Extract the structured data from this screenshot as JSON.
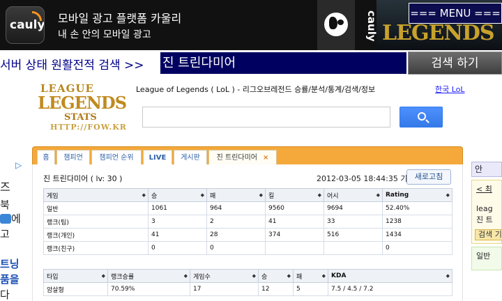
{
  "ad": {
    "brand": "cauly",
    "title": "모바일 광고 플랫폼 카울리",
    "subtitle": "내 손 안의 모바일 광고",
    "vertical_brand": "cauly",
    "logo_text": "LEGENDS",
    "menu_label": "=== MENU ==="
  },
  "search_bar": {
    "label": "서버 상태 원활전적 검색 >>",
    "value": "진 트린다미어",
    "button": "검색 하기"
  },
  "left_ad": {
    "lines": [
      "즈",
      "북",
      "에",
      "고",
      "트닝",
      "품을",
      "다"
    ]
  },
  "right_ad": {
    "box1": "안",
    "line1": "< 최",
    "line2": "leag",
    "line3": "진 트",
    "button": "검색 기",
    "line4": "일반"
  },
  "fow": {
    "logo_line1": "LEAGUE",
    "logo_line2": "LEGENDS",
    "logo_line3": "STATS",
    "logo_line4": "HTTP://FOW.KR",
    "title": "League of Legends ( LoL ) - 리그오브레전드 승률/분석/통계/검색/정보",
    "kr_link": "한국 LoL",
    "search_placeholder": ""
  },
  "tabs": [
    {
      "label": "홈"
    },
    {
      "label": "챔피언"
    },
    {
      "label": "챔피언 순위"
    },
    {
      "label": "LIVE"
    },
    {
      "label": "게시판"
    },
    {
      "label": "진 트린다미어",
      "close": "×"
    }
  ],
  "summoner": {
    "name_level": "진 트린다미어 ( lv: 30 )",
    "timestamp": "2012-03-05 18:44:35 기록",
    "refresh": "새로고침"
  },
  "stats_table": {
    "headers": [
      "게임",
      "승",
      "패",
      "킬",
      "어시",
      "Rating"
    ],
    "rows": [
      [
        "일반",
        "1061",
        "964",
        "9560",
        "9694",
        "52.40%"
      ],
      [
        "랭크(팀)",
        "3",
        "2",
        "41",
        "33",
        "1238"
      ],
      [
        "랭크(개인)",
        "41",
        "28",
        "374",
        "516",
        "1434"
      ],
      [
        "랭크(친구)",
        "0",
        "0",
        "",
        "",
        "0"
      ]
    ]
  },
  "type_table": {
    "headers": [
      "타입",
      "랭크승률",
      "게임수",
      "승",
      "패",
      "KDA"
    ],
    "rows": [
      [
        "암살형",
        "70.59%",
        "17",
        "12",
        "5",
        "7.5 / 4.5 / 7.2"
      ]
    ]
  }
}
